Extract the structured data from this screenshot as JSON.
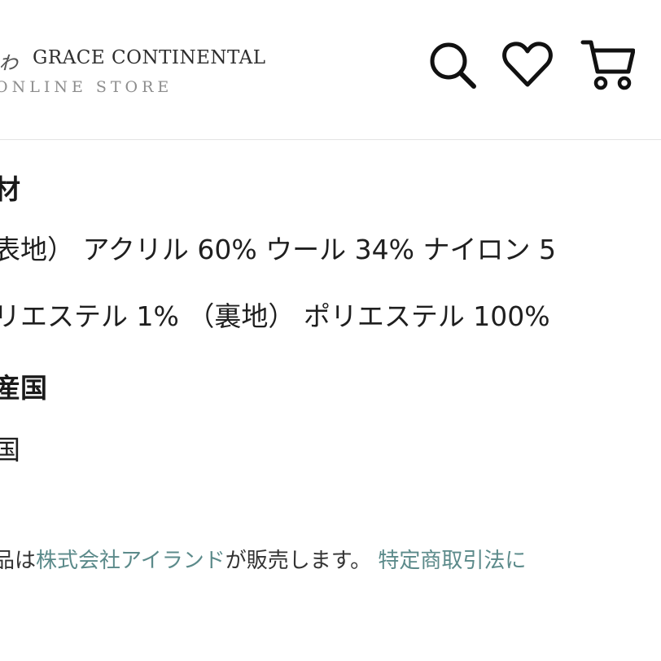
{
  "header": {
    "logo_mark": "ゎ",
    "brand_name": "GRACE CONTINENTAL",
    "brand_sub": "ONLINE STORE",
    "icons": [
      "search-icon",
      "heart-icon",
      "cart-icon"
    ]
  },
  "material": {
    "heading": "材",
    "line1": "表地） アクリル 60% ウール 34% ナイロン 5",
    "line2": "リエステル 1% （裏地） ポリエステル 100%"
  },
  "origin": {
    "heading": "産国",
    "value": "国"
  },
  "footer": {
    "prefix": "品は",
    "company_link": "株式会社アイランド",
    "middle": "が販売します。 ",
    "law_link": "特定商取引法に"
  },
  "colors": {
    "link": "#5b8a8a",
    "text": "#1f1f1f",
    "divider": "#e3e3e3"
  }
}
